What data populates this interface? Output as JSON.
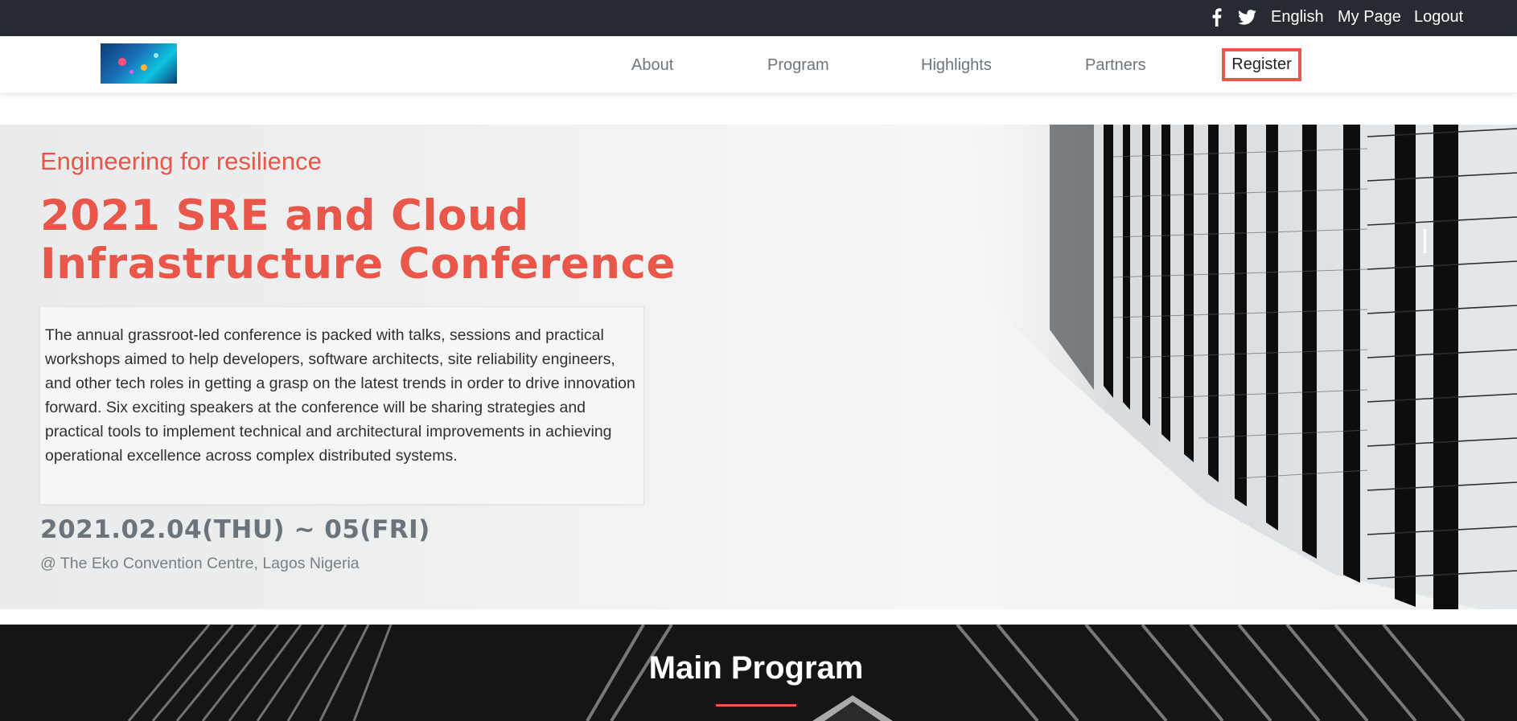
{
  "topbar": {
    "social": [
      "facebook-icon",
      "twitter-icon"
    ],
    "language": "English",
    "mypage": "My Page",
    "logout": "Logout"
  },
  "nav": {
    "items": [
      "About",
      "Program",
      "Highlights",
      "Partners"
    ],
    "register": "Register"
  },
  "hero": {
    "tagline": "Engineering for resilience",
    "title": "2021 SRE and Cloud Infrastructure Conference",
    "description": "The annual grassroot-led conference is packed with talks, sessions and practical workshops aimed to help developers, software architects, site reliability engineers, and other tech roles in getting a grasp on the latest trends in order to drive innovation forward. Six exciting speakers at the conference will be sharing strategies and practical tools to implement technical and architectural improvements in achieving operational excellence across complex distributed systems.",
    "date": "2021.02.04(THU) ~ 05(FRI)",
    "venue": "@ The Eko Convention Centre, Lagos Nigeria"
  },
  "program": {
    "title": "Main Program"
  },
  "colors": {
    "accent": "#e8574a",
    "topbar_bg": "#262a31",
    "nav_text": "#6c757d",
    "date_text": "#6b737b"
  }
}
